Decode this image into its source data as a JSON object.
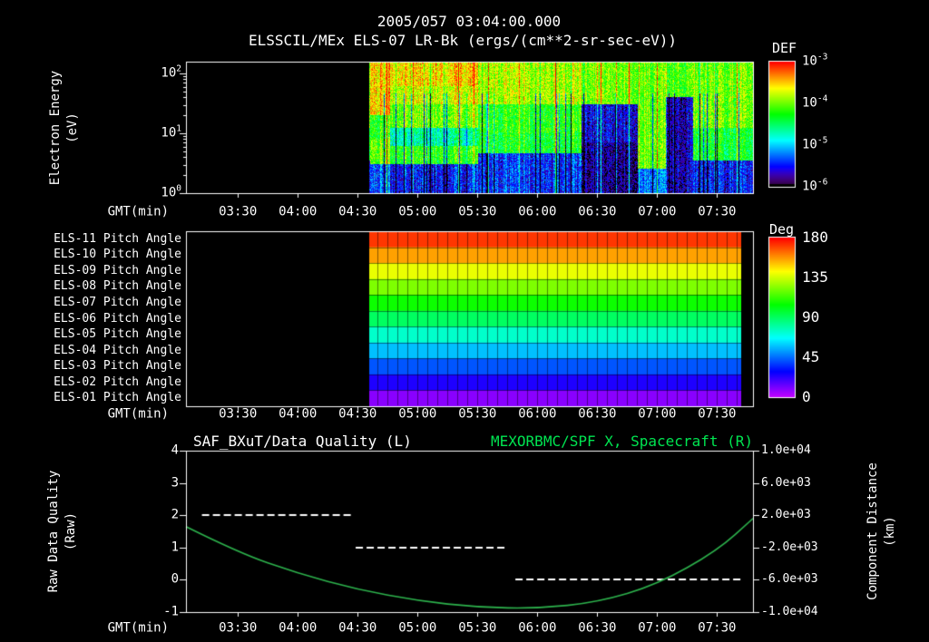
{
  "header": {
    "title": "2005/057 03:04:00.000"
  },
  "colors": {
    "background": "#000000",
    "foreground": "#ffffff",
    "accent_green": "#00e551",
    "curve_green": "#2db34d"
  },
  "chart_data": [
    {
      "type": "heatmap",
      "name": "electron-energy-spectrogram",
      "title": "ELSSCIL/MEx ELS-07 LR-Bk (ergs/(cm**2-sr-sec-eV))",
      "xlabel": "GMT(min)",
      "x_start": "03:04",
      "x_end": "07:48",
      "x_ticks": [
        "03:30",
        "04:00",
        "04:30",
        "05:00",
        "05:30",
        "06:00",
        "06:30",
        "07:00",
        "07:30"
      ],
      "ylabel_lines": [
        "Electron Energy",
        "(eV)"
      ],
      "y_scale": "log",
      "ylim_ev": [
        1,
        150
      ],
      "y_ticks": [
        "10^0",
        "10^1",
        "10^2"
      ],
      "colorbar": {
        "title": "DEF",
        "scale": "log",
        "lim": [
          1e-06,
          0.001
        ],
        "ticks": [
          "10^-3",
          "10^-4",
          "10^-5",
          "10^-6"
        ]
      },
      "data_start": "04:36",
      "data_end": "07:48",
      "noise_dex": 0.35,
      "regions": [
        {
          "t": [
            "04:36",
            "04:46"
          ],
          "bands": [
            [
              20,
              200,
              -3.5
            ],
            [
              8,
              20,
              -4.2
            ],
            [
              3,
              8,
              -4.0
            ],
            [
              1,
              3,
              -5.3
            ]
          ]
        },
        {
          "t": [
            "04:46",
            "05:30"
          ],
          "bands": [
            [
              60,
              200,
              -3.55
            ],
            [
              30,
              60,
              -3.75
            ],
            [
              12,
              30,
              -4.0
            ],
            [
              6,
              12,
              -4.7
            ],
            [
              3,
              6,
              -4.2
            ],
            [
              1,
              3,
              -5.5
            ]
          ]
        },
        {
          "t": [
            "05:30",
            "06:22"
          ],
          "bands": [
            [
              30,
              200,
              -3.8
            ],
            [
              10,
              30,
              -4.2
            ],
            [
              4.5,
              10,
              -4.3
            ],
            [
              1,
              4.5,
              -5.4
            ]
          ]
        },
        {
          "t": [
            "06:22",
            "06:50"
          ],
          "bands": [
            [
              30,
              200,
              -4.0
            ],
            [
              7,
              30,
              -5.6
            ],
            [
              1,
              7,
              -5.8
            ]
          ]
        },
        {
          "t": [
            "06:50",
            "07:04"
          ],
          "bands": [
            [
              2.5,
              200,
              -4.0
            ],
            [
              1,
              2.5,
              -5.2
            ]
          ]
        },
        {
          "t": [
            "07:04",
            "07:18"
          ],
          "bands": [
            [
              40,
              200,
              -4.1
            ],
            [
              1,
              40,
              -5.7
            ]
          ]
        },
        {
          "t": [
            "07:18",
            "07:48"
          ],
          "bands": [
            [
              12,
              200,
              -4.0
            ],
            [
              3.5,
              12,
              -4.35
            ],
            [
              1,
              3.5,
              -5.5
            ]
          ]
        }
      ]
    },
    {
      "type": "heatmap",
      "name": "pitch-angle-panels",
      "xlabel": "GMT(min)",
      "x_ticks": [
        "03:30",
        "04:00",
        "04:30",
        "05:00",
        "05:30",
        "06:00",
        "06:30",
        "07:00",
        "07:30"
      ],
      "rows": [
        {
          "label": "ELS-11 Pitch Angle",
          "deg": 172
        },
        {
          "label": "ELS-10 Pitch Angle",
          "deg": 156
        },
        {
          "label": "ELS-09 Pitch Angle",
          "deg": 139
        },
        {
          "label": "ELS-08 Pitch Angle",
          "deg": 123
        },
        {
          "label": "ELS-07 Pitch Angle",
          "deg": 106
        },
        {
          "label": "ELS-06 Pitch Angle",
          "deg": 90
        },
        {
          "label": "ELS-05 Pitch Angle",
          "deg": 74
        },
        {
          "label": "ELS-04 Pitch Angle",
          "deg": 57
        },
        {
          "label": "ELS-03 Pitch Angle",
          "deg": 41
        },
        {
          "label": "ELS-02 Pitch Angle",
          "deg": 24
        },
        {
          "label": "ELS-01 Pitch Angle",
          "deg": 8
        }
      ],
      "colorbar": {
        "title": "Deg",
        "lim": [
          0,
          180
        ],
        "ticks": [
          "180",
          "135",
          "90",
          "45",
          "0"
        ]
      },
      "data_start": "04:36",
      "data_end": "07:42",
      "cell_minutes": 5
    },
    {
      "type": "line",
      "name": "quality-and-spacecraft-distance",
      "title_left": "SAF_BXuT/Data Quality (L)",
      "title_right": "MEXORBMC/SPF X, Spacecraft (R)",
      "xlabel": "GMT(min)",
      "x_ticks": [
        "03:30",
        "04:00",
        "04:30",
        "05:00",
        "05:30",
        "06:00",
        "06:30",
        "07:00",
        "07:30"
      ],
      "ylabel_left_lines": [
        "Raw Data Quality",
        "(Raw)"
      ],
      "ylabel_right_lines": [
        "Component Distance",
        "(km)"
      ],
      "ylim_left": [
        -1,
        4
      ],
      "y_ticks_left": [
        4,
        3,
        2,
        1,
        0,
        -1
      ],
      "ylim_right": [
        -10000,
        10000
      ],
      "y_ticks_right": [
        "1.0e+04",
        "6.0e+03",
        "2.0e+03",
        "-2.0e+03",
        "-6.0e+03",
        "-1.0e+04"
      ],
      "series": [
        {
          "name": "SAF_BXuT/Data Quality",
          "axis": "left",
          "color": "#ffffff",
          "style": "dashed",
          "segments": [
            {
              "t": [
                "03:12",
                "04:27"
              ],
              "value": 2
            },
            {
              "t": [
                "04:29",
                "05:45"
              ],
              "value": 1
            },
            {
              "t": [
                "05:49",
                "07:42"
              ],
              "value": 0
            }
          ]
        },
        {
          "name": "MEXORBMC/SPF X, Spacecraft",
          "axis": "right",
          "color": "#2db34d",
          "style": "solid",
          "points": [
            [
              "03:04",
              600
            ],
            [
              "03:30",
              -2600
            ],
            [
              "04:00",
              -5200
            ],
            [
              "04:30",
              -7200
            ],
            [
              "05:00",
              -8600
            ],
            [
              "05:30",
              -9400
            ],
            [
              "06:00",
              -9550
            ],
            [
              "06:30",
              -8800
            ],
            [
              "07:00",
              -6600
            ],
            [
              "07:30",
              -2400
            ],
            [
              "07:48",
              1600
            ]
          ]
        }
      ]
    }
  ]
}
